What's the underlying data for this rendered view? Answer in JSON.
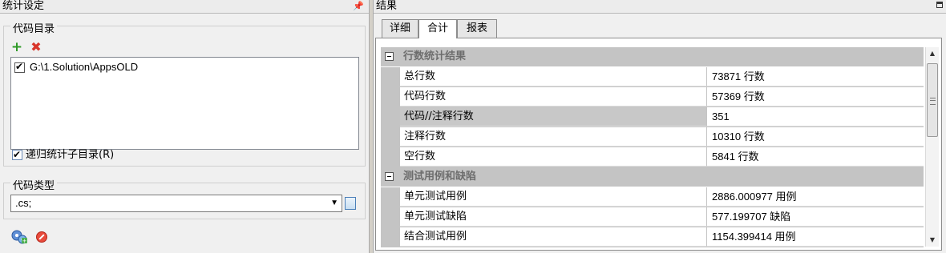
{
  "left_panel": {
    "title": "统计设定",
    "pin_glyph": "ᵖ",
    "code_dir": {
      "group_label": "代码目录",
      "add_icon": "plus-icon",
      "remove_icon": "delete-icon",
      "items": [
        {
          "checked": true,
          "path": "G:\\1.Solution\\AppsOLD"
        }
      ],
      "recursive_label": "递归统计子目录(R)",
      "recursive_checked": true
    },
    "code_type": {
      "group_label": "代码类型",
      "selected": ".cs;",
      "browse_icon": "document-icon"
    },
    "bottom": {
      "run_icon": "gears-icon",
      "stop_icon": "stop-icon"
    }
  },
  "right_panel": {
    "title": "结果",
    "tabs": [
      {
        "label": "详细",
        "active": false
      },
      {
        "label": "合计",
        "active": true
      },
      {
        "label": "报表",
        "active": false
      }
    ],
    "categories": [
      {
        "label": "行数统计结果",
        "rows": [
          {
            "name": "总行数",
            "value": "73871 行数"
          },
          {
            "name": "代码行数",
            "value": "57369 行数"
          },
          {
            "name": "代码//注释行数",
            "value": "351",
            "selected": true
          },
          {
            "name": "注释行数",
            "value": "10310 行数"
          },
          {
            "name": "空行数",
            "value": "5841 行数"
          }
        ]
      },
      {
        "label": "测试用例和缺陷",
        "rows": [
          {
            "name": "单元测试用例",
            "value": "2886.000977 用例"
          },
          {
            "name": "单元测试缺陷",
            "value": "577.199707 缺陷"
          },
          {
            "name": "结合测试用例",
            "value": "1154.399414 用例"
          }
        ]
      }
    ]
  }
}
